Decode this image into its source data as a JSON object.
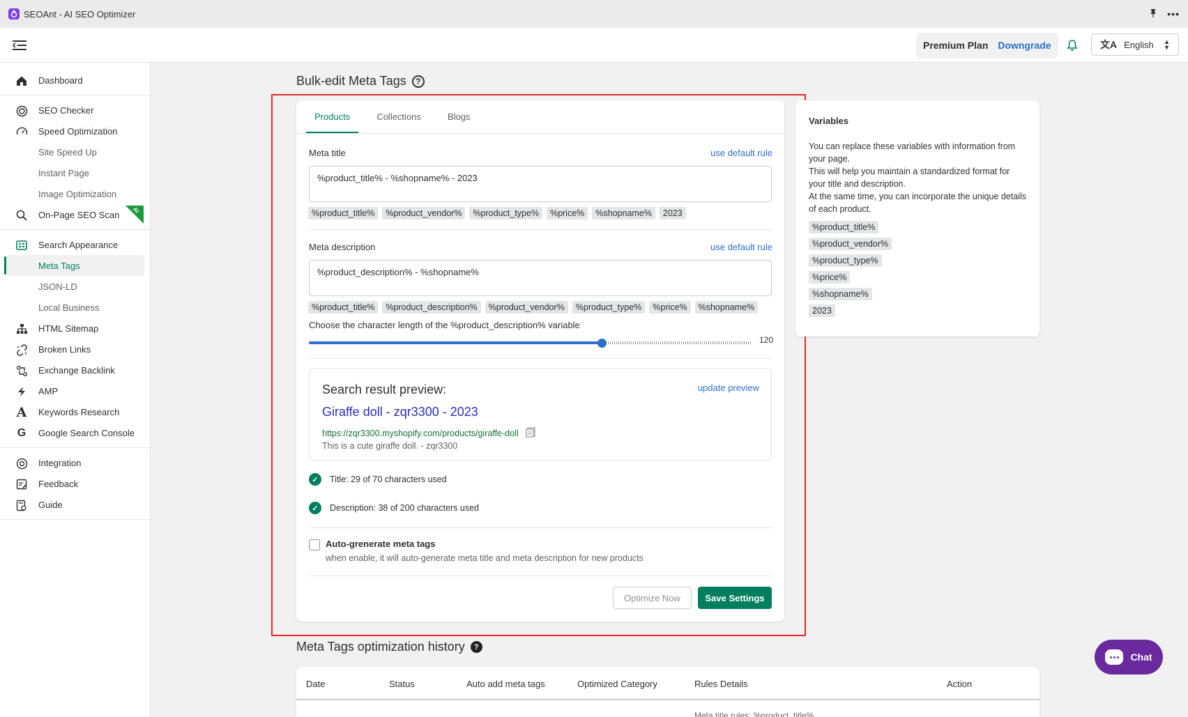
{
  "app": {
    "title": "SEOAnt - AI SEO Optimizer"
  },
  "header": {
    "plan_label": "Premium Plan",
    "plan_link": "Downgrade",
    "language": "English"
  },
  "sidebar": {
    "groups": [
      [
        {
          "label": "Dashboard",
          "icon": "home-icon"
        }
      ],
      [
        {
          "label": "SEO Checker",
          "icon": "target-icon"
        },
        {
          "label": "Speed Optimization",
          "icon": "speedometer-icon"
        },
        {
          "label": "Site Speed Up",
          "sub": true
        },
        {
          "label": "Instant Page",
          "sub": true
        },
        {
          "label": "Image Optimization",
          "sub": true
        },
        {
          "label": "On-Page SEO Scan",
          "icon": "search-icon",
          "badge": "AI"
        }
      ],
      [
        {
          "label": "Search Appearance",
          "icon": "grid-icon"
        },
        {
          "label": "Meta Tags",
          "sub": true,
          "active": true
        },
        {
          "label": "JSON-LD",
          "sub": true
        },
        {
          "label": "Local Business",
          "sub": true
        },
        {
          "label": "HTML Sitemap",
          "icon": "sitemap-icon"
        },
        {
          "label": "Broken Links",
          "icon": "broken-link-icon"
        },
        {
          "label": "Exchange Backlink",
          "icon": "exchange-icon"
        },
        {
          "label": "AMP",
          "icon": "lightning-icon"
        },
        {
          "label": "Keywords Research",
          "icon": "letter-a-icon"
        },
        {
          "label": "Google Search Console",
          "icon": "google-icon"
        }
      ],
      [
        {
          "label": "Integration",
          "icon": "integration-icon"
        },
        {
          "label": "Feedback",
          "icon": "feedback-icon"
        },
        {
          "label": "Guide",
          "icon": "guide-icon"
        }
      ]
    ]
  },
  "page": {
    "title": "Bulk-edit Meta Tags"
  },
  "tabs": [
    "Products",
    "Collections",
    "Blogs"
  ],
  "meta_title": {
    "label": "Meta title",
    "rule_link": "use default rule",
    "value": "%product_title% - %shopname% - 2023",
    "chips": [
      "%product_title%",
      "%product_vendor%",
      "%product_type%",
      "%price%",
      "%shopname%",
      "2023"
    ]
  },
  "meta_description": {
    "label": "Meta description",
    "rule_link": "use default rule",
    "value": "%product_description% - %shopname%",
    "chips": [
      "%product_title%",
      "%product_description%",
      "%product_vendor%",
      "%product_type%",
      "%price%",
      "%shopname%"
    ]
  },
  "slider": {
    "label": "Choose the character length of the %product_description% variable",
    "value": 120,
    "min": 0,
    "max": 200
  },
  "preview": {
    "heading": "Search result preview:",
    "update_link": "update preview",
    "title": "Giraffe doll - zqr3300 - 2023",
    "url": "https://zqr3300.myshopify.com/products/giraffe-doll",
    "description": "This is a cute giraffe doll. - zqr3300"
  },
  "checks": {
    "title": "Title: 29 of 70 characters used",
    "description": "Description: 38 of 200 characters used"
  },
  "auto_generate": {
    "label": "Auto-grenerate meta tags",
    "hint": "when enable, it will auto-generate meta title and meta description for new products",
    "checked": false
  },
  "buttons": {
    "optimize": "Optimize Now",
    "save": "Save Settings"
  },
  "variables": {
    "title": "Variables",
    "description_lines": [
      "You can replace these variables with information from your page.",
      "This will help you maintain a standardized format for your title and description.",
      "At the same time, you can incorporate the unique details of each product."
    ],
    "items": [
      "%product_title%",
      "%product_vendor%",
      "%product_type%",
      "%price%",
      "%shopname%",
      "2023"
    ]
  },
  "history": {
    "title": "Meta Tags optimization history",
    "columns": [
      "Date",
      "Status",
      "Auto add meta tags",
      "Optimized Category",
      "Rules Details",
      "Action"
    ],
    "snippet": "Meta title rules: %product_title%"
  },
  "chat": {
    "label": "Chat"
  },
  "colors": {
    "accent": "#007f5f",
    "link": "#2c6ecb",
    "frame": "#e22b2b",
    "chat": "#6a2a9e"
  }
}
